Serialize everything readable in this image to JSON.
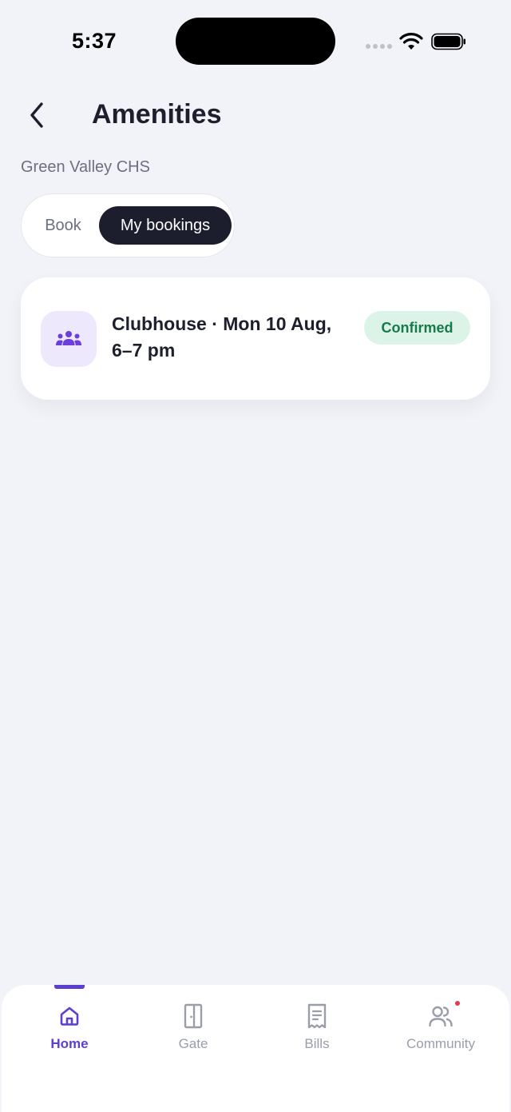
{
  "status_bar": {
    "time": "5:37"
  },
  "header": {
    "title": "Amenities",
    "subtitle": "Green Valley CHS"
  },
  "tabs": [
    {
      "label": "Book",
      "selected": false
    },
    {
      "label": "My bookings",
      "selected": true
    }
  ],
  "bookings": [
    {
      "icon": "group-icon",
      "title": "Clubhouse · Mon 10 Aug, 6–7 pm",
      "status": "Confirmed"
    }
  ],
  "bottom_nav": [
    {
      "label": "Home",
      "icon": "home-icon",
      "active": true
    },
    {
      "label": "Gate",
      "icon": "door-icon",
      "active": false
    },
    {
      "label": "Bills",
      "icon": "receipt-icon",
      "active": false
    },
    {
      "label": "Community",
      "icon": "people-icon",
      "active": false,
      "notification_dot": true
    }
  ],
  "colors": {
    "accent": "#5c3fd1",
    "background": "#f2f3f8",
    "dark": "#1c1e2d",
    "success_bg": "#dcf4e7",
    "success_text": "#177a4a",
    "notification": "#e53950"
  }
}
